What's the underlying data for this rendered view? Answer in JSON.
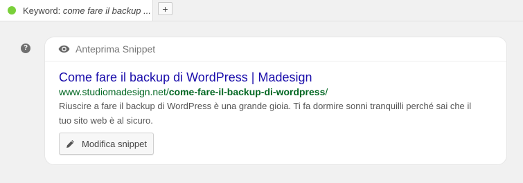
{
  "tabs": {
    "active": {
      "prefix": "Keyword: ",
      "keyword": "come fare il backup ...",
      "status_color": "#7ad03a"
    },
    "add_label": "+"
  },
  "help_icon": {
    "glyph": "?",
    "icon": "question-circle-icon"
  },
  "snippet_preview": {
    "header_icon": "eye-icon",
    "header_title": "Anteprima Snippet",
    "title": "Come fare il backup di WordPress | Madesign",
    "url_base": "www.studiomadesign.net/",
    "url_slug": "come-fare-il-backup-di-wordpress",
    "url_end": "/",
    "description": "Riuscire a fare il backup di WordPress è una grande gioia. Ti fa dormire sonni tranquilli perché sai che il tuo sito web è al sicuro.",
    "edit_button_icon": "pencil-icon",
    "edit_button_label": "Modifica snippet"
  },
  "colors": {
    "title_link": "#1a0dab",
    "url_green": "#006621",
    "description": "#545454",
    "background": "#f1f1f1"
  }
}
